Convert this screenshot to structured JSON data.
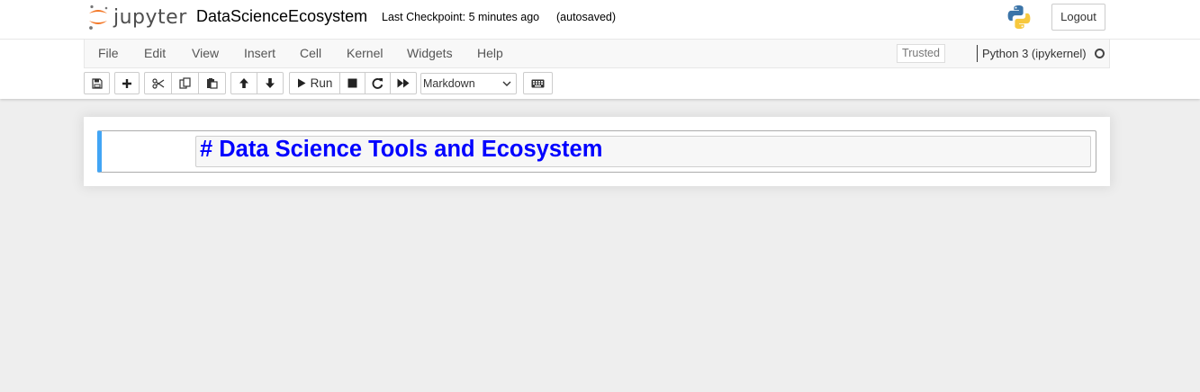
{
  "header": {
    "logo_text": "jupyter",
    "notebook_name": "DataScienceEcosystem",
    "checkpoint_text": "Last Checkpoint: 5 minutes ago",
    "autosave_text": "(autosaved)",
    "logout_label": "Logout"
  },
  "menubar": {
    "items": [
      "File",
      "Edit",
      "View",
      "Insert",
      "Cell",
      "Kernel",
      "Widgets",
      "Help"
    ],
    "trusted_label": "Trusted",
    "kernel_name": "Python 3 (ipykernel)"
  },
  "toolbar": {
    "run_label": "Run",
    "cell_type_selected": "Markdown",
    "icons": [
      "save-icon",
      "plus-icon",
      "cut-icon",
      "copy-icon",
      "paste-icon",
      "arrow-up-icon",
      "arrow-down-icon",
      "play-icon",
      "stop-icon",
      "restart-icon",
      "fast-forward-icon",
      "keyboard-icon"
    ]
  },
  "cells": [
    {
      "type": "markdown",
      "source": "# Data Science Tools and Ecosystem"
    }
  ],
  "colors": {
    "cell_accent": "#42a5f5",
    "markdown_text": "#0000ff",
    "jupyter_orange": "#f37726",
    "page_bg": "#eeeeee"
  }
}
